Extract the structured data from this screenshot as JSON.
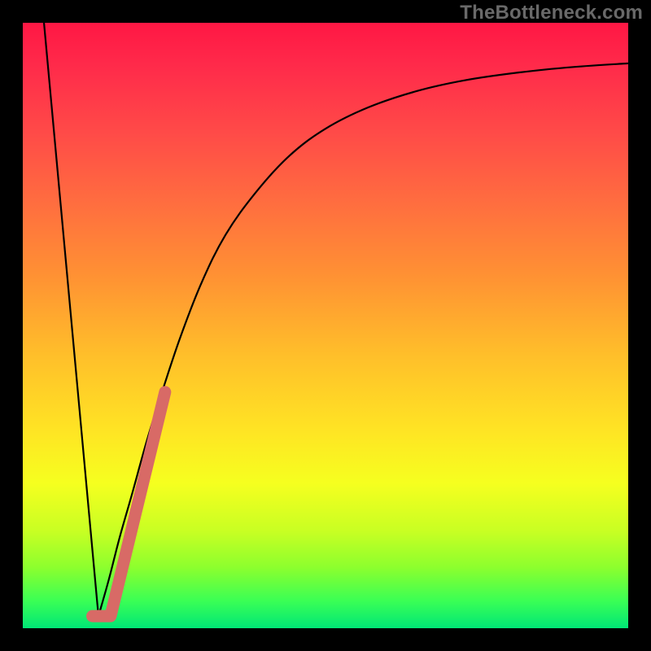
{
  "watermark": {
    "text": "TheBottleneck.com"
  },
  "chart_data": {
    "type": "line",
    "title": "",
    "xlabel": "",
    "ylabel": "",
    "xlim": [
      0,
      100
    ],
    "ylim": [
      0,
      100
    ],
    "grid": false,
    "legend": false,
    "background_gradient_stops": [
      {
        "offset": 0.0,
        "color": "#ff1744"
      },
      {
        "offset": 0.07,
        "color": "#ff2a4a"
      },
      {
        "offset": 0.18,
        "color": "#ff4a48"
      },
      {
        "offset": 0.3,
        "color": "#ff6e3f"
      },
      {
        "offset": 0.42,
        "color": "#ff9233"
      },
      {
        "offset": 0.55,
        "color": "#ffbf2a"
      },
      {
        "offset": 0.67,
        "color": "#ffe324"
      },
      {
        "offset": 0.76,
        "color": "#f6ff1f"
      },
      {
        "offset": 0.84,
        "color": "#c8ff23"
      },
      {
        "offset": 0.9,
        "color": "#8cff2e"
      },
      {
        "offset": 0.955,
        "color": "#3aff55"
      },
      {
        "offset": 1.0,
        "color": "#00e676"
      }
    ],
    "series": [
      {
        "name": "left-descent",
        "stroke": "#000000",
        "stroke_width": 2.2,
        "points": [
          {
            "x": 3.5,
            "y": 100
          },
          {
            "x": 12.5,
            "y": 2
          }
        ]
      },
      {
        "name": "right-curve",
        "stroke": "#000000",
        "stroke_width": 2.2,
        "points": [
          {
            "x": 12.5,
            "y": 2
          },
          {
            "x": 14.2,
            "y": 8
          },
          {
            "x": 16.0,
            "y": 15
          },
          {
            "x": 18.0,
            "y": 22
          },
          {
            "x": 20.5,
            "y": 31
          },
          {
            "x": 23.0,
            "y": 39
          },
          {
            "x": 26.0,
            "y": 48
          },
          {
            "x": 29.5,
            "y": 57
          },
          {
            "x": 33.5,
            "y": 65
          },
          {
            "x": 38.5,
            "y": 72
          },
          {
            "x": 44.0,
            "y": 78
          },
          {
            "x": 50.0,
            "y": 82.5
          },
          {
            "x": 57.0,
            "y": 86
          },
          {
            "x": 65.0,
            "y": 88.7
          },
          {
            "x": 73.0,
            "y": 90.5
          },
          {
            "x": 82.0,
            "y": 91.8
          },
          {
            "x": 91.0,
            "y": 92.7
          },
          {
            "x": 100.0,
            "y": 93.3
          }
        ]
      },
      {
        "name": "highlight-bar",
        "stroke": "#d86a66",
        "stroke_width": 15,
        "linecap": "round",
        "points": [
          {
            "x": 11.5,
            "y": 2
          },
          {
            "x": 14.5,
            "y": 2
          },
          {
            "x": 23.5,
            "y": 39
          }
        ]
      }
    ]
  }
}
